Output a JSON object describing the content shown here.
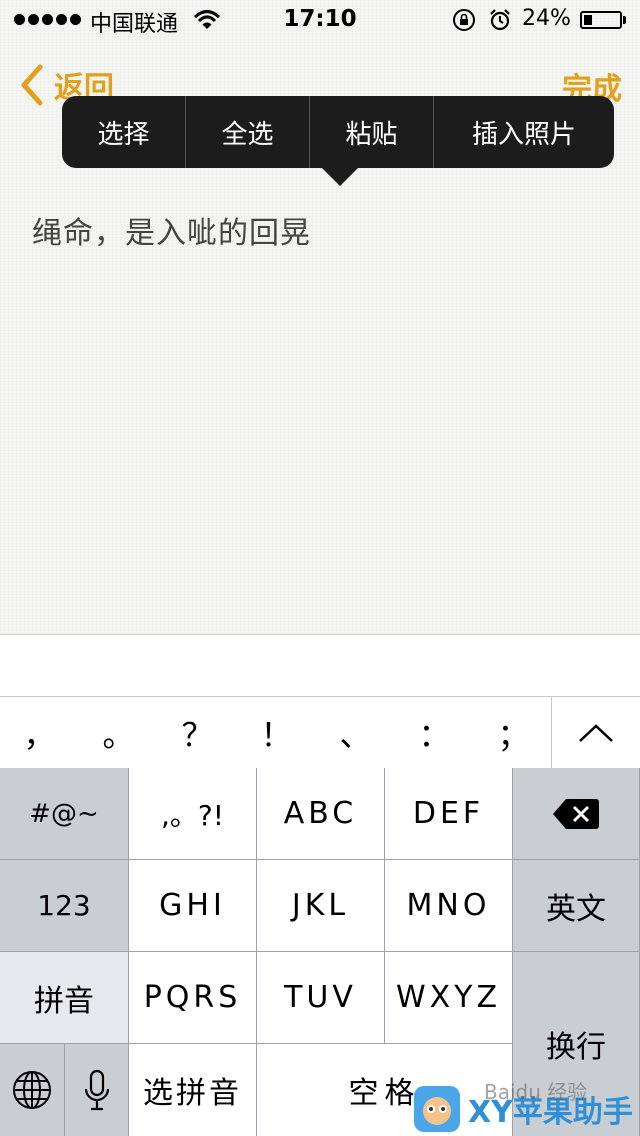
{
  "status_bar": {
    "carrier": "中国联通",
    "time": "17:10",
    "battery_percent": "24%",
    "battery_level": 0.24,
    "icons": [
      "signal-dots",
      "wifi-icon",
      "rotation-lock-icon",
      "alarm-icon",
      "battery-icon"
    ]
  },
  "nav": {
    "back_label": "返回",
    "done_label": "完成",
    "accent_color": "#e0a21a"
  },
  "edit_menu": {
    "items": [
      "选择",
      "全选",
      "粘贴",
      "插入照片"
    ]
  },
  "note": {
    "text": "绳命，是入呲的回晃"
  },
  "punctuation_bar": {
    "keys": [
      "，",
      "。",
      "？",
      "！",
      "、",
      "：",
      "；"
    ],
    "collapse_icon": "chevron-up-icon"
  },
  "keyboard": {
    "symbols": "#@~",
    "punct": ",。?!",
    "abc": "ABC",
    "def": "DEF",
    "num": "123",
    "ghi": "GHI",
    "jkl": "JKL",
    "mno": "MNO",
    "english": "英文",
    "pinyin": "拼音",
    "pqrs": "PQRS",
    "tuv": "TUV",
    "wxyz": "WXYZ",
    "select_pinyin": "选拼音",
    "space": "空格",
    "return": "换行"
  },
  "watermark": {
    "text": "XY苹果助手",
    "baidu": "Baidu 经验"
  }
}
